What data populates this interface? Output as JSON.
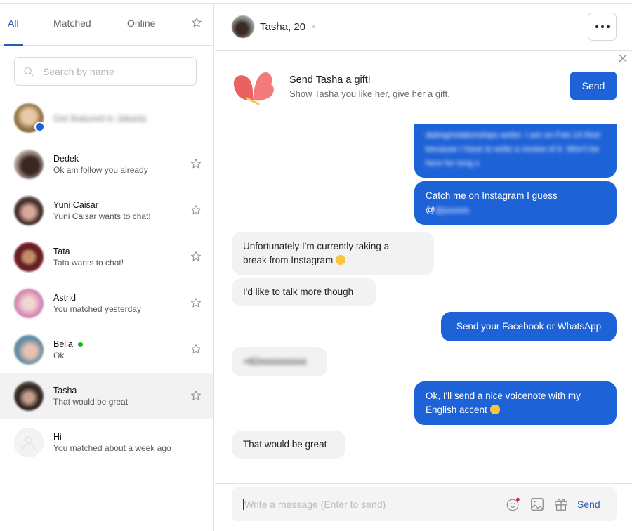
{
  "tabs": {
    "items": [
      {
        "label": "All",
        "active": true
      },
      {
        "label": "Matched",
        "active": false
      },
      {
        "label": "Online",
        "active": false
      }
    ],
    "favorites_icon": "star-icon"
  },
  "search": {
    "placeholder": "Search by name",
    "value": ""
  },
  "featured": {
    "text": "Get featured in Jakarta",
    "badge_icon": "plus-badge-icon"
  },
  "contacts": [
    {
      "name": "Dedek",
      "preview": "Ok am follow you already",
      "online": false,
      "selected": false
    },
    {
      "name": "Yuni Caisar",
      "preview": "Yuni Caisar wants to chat!",
      "online": false,
      "selected": false
    },
    {
      "name": "Tata",
      "preview": "Tata wants to chat!",
      "online": false,
      "selected": false
    },
    {
      "name": "Astrid",
      "preview": "You matched yesterday",
      "online": false,
      "selected": false
    },
    {
      "name": "Bella",
      "preview": "Ok",
      "online": true,
      "selected": false
    },
    {
      "name": "Tasha",
      "preview": "That would be great",
      "online": false,
      "selected": true
    },
    {
      "name": "Hi",
      "preview": "You matched about a week ago",
      "online": false,
      "selected": false
    }
  ],
  "chat": {
    "header": {
      "name_age": "Tasha, 20",
      "more_icon": "ellipsis-icon"
    },
    "gift_banner": {
      "title": "Send Tasha a gift!",
      "subtitle": "Show Tasha you like her, give her a gift.",
      "send_label": "Send",
      "close_icon": "close-icon"
    },
    "messages": [
      {
        "direction": "out",
        "text": "dating/relationships writer. I am on Feb 14 Red because I have to write a review of it. Won't be here for long x",
        "blurred": true
      },
      {
        "direction": "out",
        "text": "Catch me on Instagram I guess",
        "text2": "@jasetolo",
        "blurred_second_line": true
      },
      {
        "direction": "in",
        "text": "Unfortunately I'm currently taking a",
        "text2": "break from Instagram",
        "emoji": "sweat-smile"
      },
      {
        "direction": "in",
        "text": "I'd like to talk more though"
      },
      {
        "direction": "out",
        "text": "Send your Facebook or WhatsApp"
      },
      {
        "direction": "in",
        "text": "+62xxxxxxxxxx",
        "blurred": true
      },
      {
        "direction": "out",
        "text": "Ok, I'll send a nice voicenote with my",
        "text2": "English accent",
        "emoji": "smiling-face"
      },
      {
        "direction": "in",
        "text": "That would be great"
      }
    ],
    "composer": {
      "placeholder": "Write a message (Enter to send)",
      "value": "",
      "send_label": "Send",
      "icons": [
        "emoji-icon",
        "image-icon",
        "gift-icon"
      ]
    }
  },
  "colors": {
    "accent": "#1e62d8",
    "tab_active": "#2a5db0",
    "online": "#1bb41b",
    "incoming_bubble": "#f2f2f2"
  }
}
